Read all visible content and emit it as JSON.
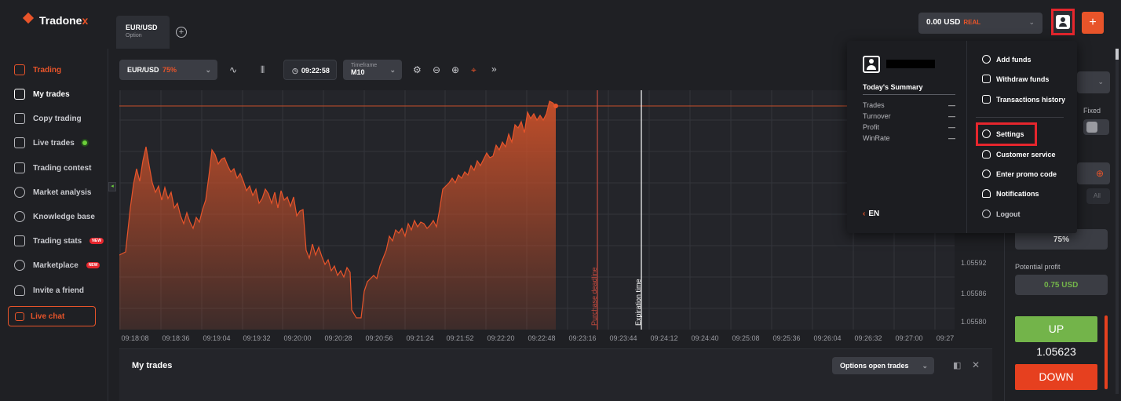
{
  "brand": {
    "name_main": "Tradone",
    "name_accent": "x"
  },
  "tabs": [
    {
      "pair": "EUR/USD",
      "type": "Option"
    }
  ],
  "account": {
    "balance": "0.00 USD",
    "mode": "REAL"
  },
  "sidebar": {
    "items": [
      {
        "label": "Trading"
      },
      {
        "label": "My trades"
      },
      {
        "label": "Copy trading"
      },
      {
        "label": "Live trades"
      },
      {
        "label": "Trading contest"
      },
      {
        "label": "Market analysis"
      },
      {
        "label": "Knowledge base"
      },
      {
        "label": "Trading stats",
        "badge": "NEW"
      },
      {
        "label": "Marketplace",
        "badge": "NEW"
      },
      {
        "label": "Invite a friend"
      }
    ],
    "live_chat": "Live chat"
  },
  "toolbar": {
    "asset": "EUR/USD",
    "payout": "75%",
    "time": "09:22:58",
    "timeframe_label": "Timeframe",
    "timeframe_value": "M10"
  },
  "chart": {
    "x_ticks": [
      "09:18:08",
      "09:18:36",
      "09:19:04",
      "09:19:32",
      "09:20:00",
      "09:20:28",
      "09:20:56",
      "09:21:24",
      "09:21:52",
      "09:22:20",
      "09:22:48",
      "09:23:16",
      "09:23:44",
      "09:24:12",
      "09:24:40",
      "09:25:08",
      "09:25:36",
      "09:26:04",
      "09:26:32",
      "09:27:00",
      "09:27"
    ],
    "y_ticks": [
      "1.05592",
      "1.05586",
      "1.05580"
    ],
    "purchase_deadline_label": "Purchase deadline",
    "expiration_label": "Expiration time"
  },
  "right_panel": {
    "fixed_label": "Fixed",
    "all_label": "All",
    "payout_value": "75%",
    "potential_profit_label": "Potential profit",
    "potential_profit_value": "0.75 USD",
    "up_label": "UP",
    "current_price": "1.05623",
    "down_label": "DOWN"
  },
  "bottom_panel": {
    "title": "My trades",
    "filter": "Options open trades"
  },
  "profile_menu": {
    "summary_title": "Today's Summary",
    "summary_rows": [
      {
        "label": "Trades",
        "value": "—"
      },
      {
        "label": "Turnover",
        "value": "—"
      },
      {
        "label": "Profit",
        "value": "—"
      },
      {
        "label": "WinRate",
        "value": "—"
      }
    ],
    "language": "EN",
    "items": [
      {
        "label": "Add funds"
      },
      {
        "label": "Withdraw funds"
      },
      {
        "label": "Transactions history"
      },
      {
        "label": "Settings"
      },
      {
        "label": "Customer service"
      },
      {
        "label": "Enter promo code"
      },
      {
        "label": "Notifications"
      },
      {
        "label": "Logout"
      }
    ]
  },
  "colors": {
    "accent": "#e8542a",
    "up": "#73b44a",
    "down": "#e6401f",
    "highlight": "#e6262d"
  }
}
